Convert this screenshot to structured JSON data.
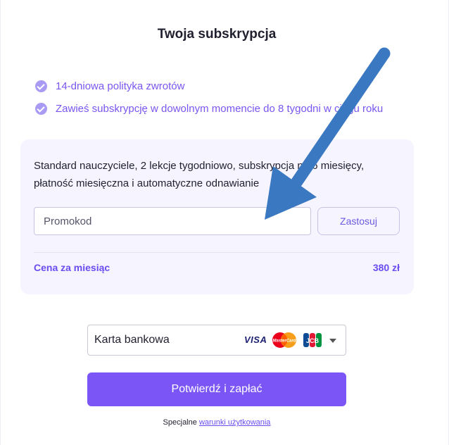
{
  "title": "Twoja subskrypcja",
  "benefits": [
    {
      "icon": "check-circle-icon",
      "text": "14-dniowa polityka zwrotów"
    },
    {
      "icon": "check-circle-icon",
      "text": "Zawieś subskrypcję w dowolnym momencie do 8 tygodni w ciągu roku"
    }
  ],
  "plan": {
    "description": "Standard nauczyciele, 2 lekcje tygodniowo, subskrypcja na 6 miesięcy, płatność miesięczna i automatyczne odnawianie",
    "promo": {
      "placeholder": "Promokod",
      "value": ""
    },
    "apply_label": "Zastosuj",
    "price_label": "Cena za miesiąc",
    "price_value": "380 zł"
  },
  "payment": {
    "selected": "Karta bankowa",
    "card_logos": [
      "VISA",
      "MasterCard",
      "JCB"
    ]
  },
  "confirm_label": "Potwierdź i zapłać",
  "terms": {
    "prefix": "Specjalne",
    "link": "warunki użytkowania"
  },
  "colors": {
    "accent": "#7b55f5",
    "accent_text": "#6a4cf0",
    "card_bg": "#f6f4ff",
    "annotation_arrow": "#3a78c2"
  }
}
